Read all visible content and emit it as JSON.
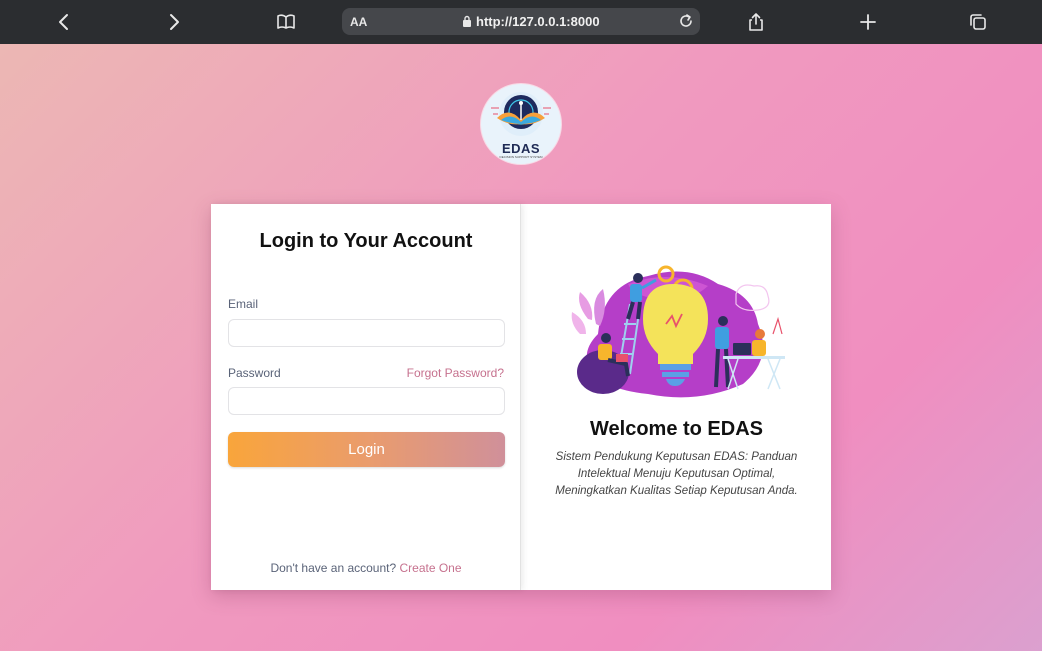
{
  "browser": {
    "url": "http://127.0.0.1:8000",
    "text_size_label": "AA"
  },
  "logo": {
    "title": "EDAS",
    "subtitle": "DECISION SUPPORT SYSTEM"
  },
  "login": {
    "title": "Login to Your Account",
    "email_label": "Email",
    "email_value": "",
    "password_label": "Password",
    "password_value": "",
    "forgot_label": "Forgot Password?",
    "submit_label": "Login",
    "signup_prompt": "Don't have an account?",
    "signup_link": "Create One"
  },
  "welcome": {
    "title": "Welcome to EDAS",
    "tagline": "Sistem Pendukung Keputusan EDAS: Panduan Intelektual Menuju Keputusan Optimal, Meningkatkan Kualitas Setiap Keputusan Anda."
  },
  "colors": {
    "accent": "#c6718e",
    "button_start": "#f9a53b",
    "button_end": "#d0909a",
    "toolbar_bg": "#2b2d30"
  }
}
